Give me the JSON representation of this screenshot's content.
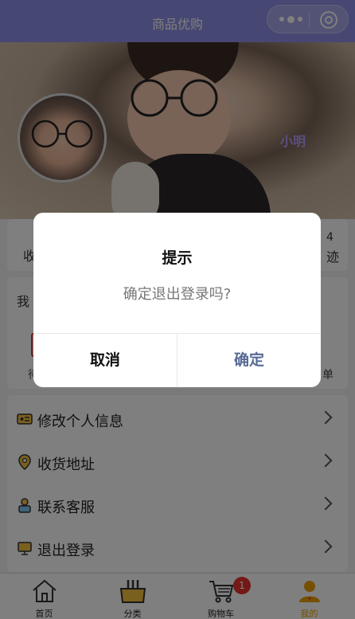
{
  "header": {
    "title": "商品优购"
  },
  "profile": {
    "username": "小明"
  },
  "stats": {
    "left_label": "收",
    "right_number": "4",
    "right_label": "迹"
  },
  "orders": {
    "heading": "我",
    "left_label": "待",
    "right_label": "单"
  },
  "menu": {
    "items": [
      {
        "label": "修改个人信息",
        "icon": "id-card-icon"
      },
      {
        "label": "收货地址",
        "icon": "location-pin-icon"
      },
      {
        "label": "联系客服",
        "icon": "customer-service-icon"
      },
      {
        "label": "退出登录",
        "icon": "logout-icon"
      }
    ]
  },
  "tabbar": {
    "tabs": [
      {
        "label": "首页",
        "icon": "home-icon"
      },
      {
        "label": "分类",
        "icon": "category-basket-icon"
      },
      {
        "label": "购物车",
        "icon": "cart-icon",
        "badge": "1"
      },
      {
        "label": "我的",
        "icon": "user-icon",
        "active": true
      }
    ]
  },
  "dialog": {
    "title": "提示",
    "message": "确定退出登录吗?",
    "cancel_label": "取消",
    "confirm_label": "确定"
  },
  "colors": {
    "header_bg": "#8e8ee6",
    "username": "#b7a0ff",
    "active_tab": "#e8a100",
    "confirm": "#576b95",
    "badge": "#e8322f"
  }
}
